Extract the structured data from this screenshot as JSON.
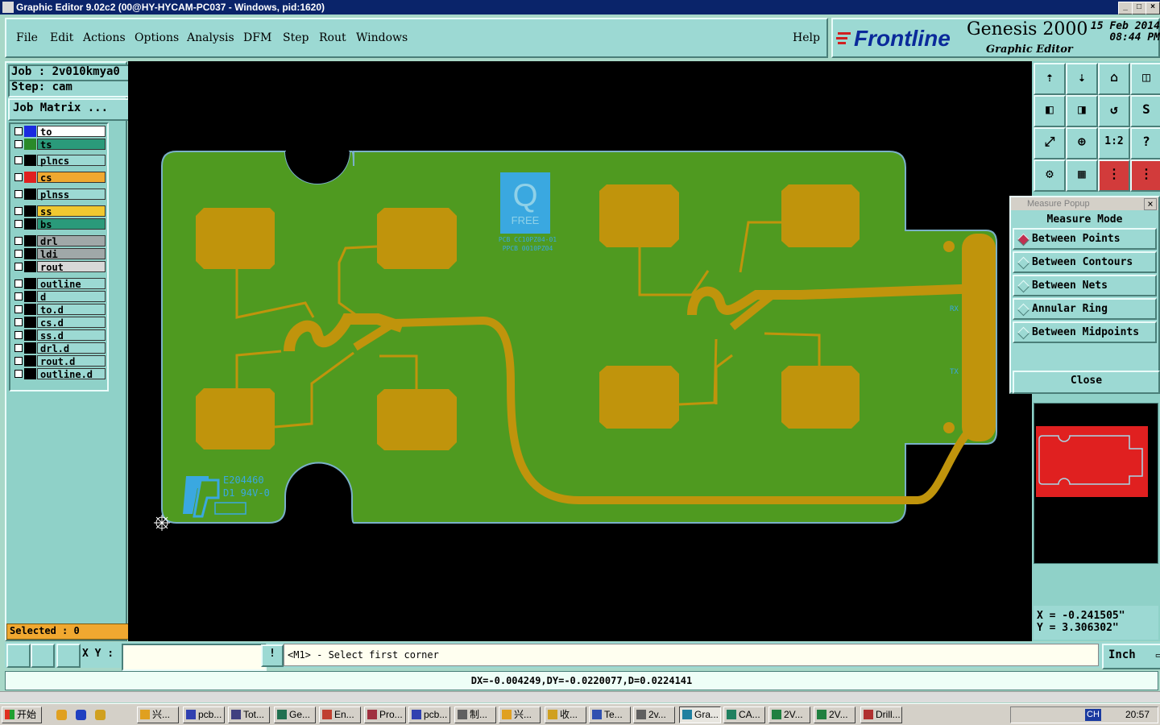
{
  "window": {
    "title": "Graphic Editor 9.02c2 (00@HY-HYCAM-PC037 - Windows, pid:1620)"
  },
  "menu": {
    "items": [
      "File",
      "Edit",
      "Actions",
      "Options",
      "Analysis",
      "DFM",
      "Step",
      "Rout",
      "Windows"
    ],
    "help": "Help"
  },
  "brand": {
    "logo": "Frontline",
    "product": "Genesis 2000",
    "subtitle": "Graphic Editor",
    "date": "15 Feb 2014",
    "time": "08:44 PM"
  },
  "job": {
    "job_label": "Job : 2v010kmya0",
    "step_label": "Step: cam",
    "matrix_button": "Job Matrix ..."
  },
  "layers": [
    {
      "name": "to",
      "color": "#1a2ae0",
      "bg": "#ffffff"
    },
    {
      "name": "ts",
      "color": "#2a8a2a",
      "bg": "#2a9a7a"
    },
    {
      "name": "plncs",
      "color": "#000000",
      "bg": "#9cd9d3"
    },
    {
      "name": "cs",
      "color": "#e02020",
      "bg": "#f0a830"
    },
    {
      "name": "plnss",
      "color": "#000000",
      "bg": "#9cd9d3"
    },
    {
      "name": "ss",
      "color": "#000000",
      "bg": "#f0c830"
    },
    {
      "name": "bs",
      "color": "#000000",
      "bg": "#2a9a7a"
    },
    {
      "name": "drl",
      "color": "#000000",
      "bg": "#a0a8a8"
    },
    {
      "name": "ldi",
      "color": "#000000",
      "bg": "#a0a8a8"
    },
    {
      "name": "rout",
      "color": "#000000",
      "bg": "#d8d8d8"
    },
    {
      "name": "outline",
      "color": "#000000",
      "bg": "#9cd9d3"
    },
    {
      "name": "d",
      "color": "#000000",
      "bg": "#9cd9d3"
    },
    {
      "name": "to.d",
      "color": "#000000",
      "bg": "#9cd9d3"
    },
    {
      "name": "cs.d",
      "color": "#000000",
      "bg": "#9cd9d3"
    },
    {
      "name": "ss.d",
      "color": "#000000",
      "bg": "#9cd9d3"
    },
    {
      "name": "drl.d",
      "color": "#000000",
      "bg": "#9cd9d3"
    },
    {
      "name": "rout.d",
      "color": "#000000",
      "bg": "#9cd9d3"
    },
    {
      "name": "outline.d",
      "color": "#000000",
      "bg": "#9cd9d3"
    }
  ],
  "selected": "Selected : 0",
  "board": {
    "qfree_letter": "Q",
    "qfree_word": "FREE",
    "pcb_line1": "PCB CC10PZ04-01",
    "pcb_line2": "PPCB 0010PZ04",
    "ul_line1": "E204460",
    "ul_line2": "D1 94V-0",
    "rx": "RX",
    "tx": "TX"
  },
  "toolbar": {
    "one_to_two": "1:2",
    "help_q": "?"
  },
  "measure": {
    "title": "Measure Popup",
    "mode_label": "Measure Mode",
    "options": [
      "Between Points",
      "Between Contours",
      "Between Nets",
      "Annular Ring",
      "Between Midpoints"
    ],
    "selected_index": 0,
    "close": "Close"
  },
  "coords": {
    "x": "X = -0.241505\"",
    "y": "Y = 3.306302\""
  },
  "command": {
    "xy_label": "X Y :",
    "xy_value": "",
    "prompt": "<M1> - Select first corner",
    "unit": "Inch",
    "bang": "!"
  },
  "status": {
    "delta": "DX=-0.004249,DY=-0.0220077,D=0.0224141"
  },
  "taskbar": {
    "start": "开始",
    "tasks": [
      "兴...",
      "pcb...",
      "Tot...",
      "Ge...",
      "En...",
      "Pro...",
      "pcb...",
      "制...",
      "兴...",
      "收...",
      "Te...",
      "2v...",
      "Gra...",
      "CA...",
      "2V...",
      "2V...",
      "Drill..."
    ],
    "active_index": 12,
    "tray_lang": "CH",
    "clock": "20:57"
  }
}
